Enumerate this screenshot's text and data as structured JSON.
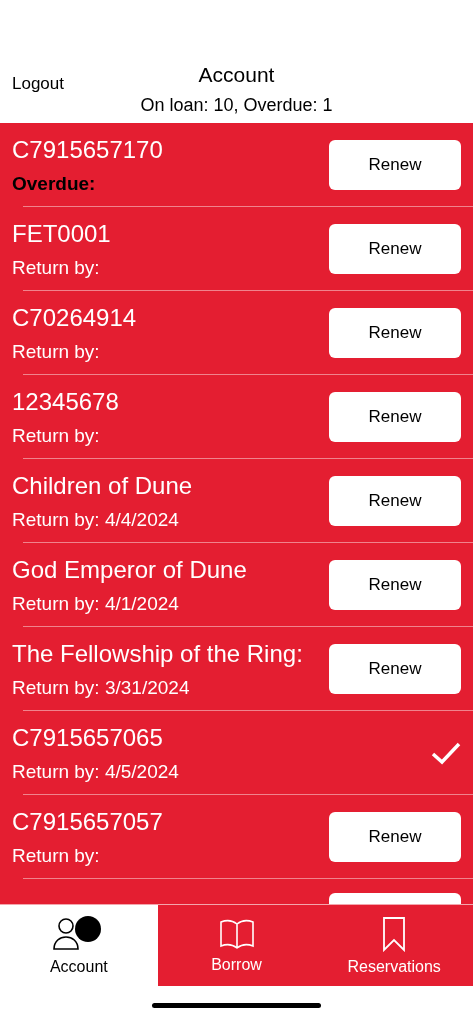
{
  "header": {
    "logout": "Logout",
    "title": "Account",
    "summary": "On loan: 10, Overdue: 1"
  },
  "loans": [
    {
      "title": "C7915657170",
      "due": "Overdue:",
      "overdue": true,
      "kind": "renewable",
      "action": "Renew"
    },
    {
      "title": "FET0001",
      "due": "Return by:",
      "overdue": false,
      "kind": "renewable",
      "action": "Renew"
    },
    {
      "title": "C70264914",
      "due": "Return by:",
      "overdue": false,
      "kind": "renewable",
      "action": "Renew"
    },
    {
      "title": "12345678",
      "due": "Return by:",
      "overdue": false,
      "kind": "renewable",
      "action": "Renew"
    },
    {
      "title": "Children of Dune",
      "due": "Return by: 4/4/2024",
      "overdue": false,
      "kind": "renewable",
      "action": "Renew"
    },
    {
      "title": "God Emperor of Dune",
      "due": "Return by: 4/1/2024",
      "overdue": false,
      "kind": "renewable",
      "action": "Renew"
    },
    {
      "title": "The Fellowship of the Ring:",
      "due": "Return by: 3/31/2024",
      "overdue": false,
      "kind": "renewable",
      "action": "Renew"
    },
    {
      "title": "C7915657065",
      "due": "Return by: 4/5/2024",
      "overdue": false,
      "kind": "renewed"
    },
    {
      "title": "C7915657057",
      "due": "Return by:",
      "overdue": false,
      "kind": "renewable",
      "action": "Renew"
    },
    {
      "kind": "renewable"
    }
  ],
  "tabs": [
    {
      "label": "Account",
      "selected": true,
      "kind": "person"
    },
    {
      "label": "Borrow",
      "selected": false,
      "kind": "book"
    },
    {
      "label": "Reservations",
      "selected": false,
      "kind": "bookmark"
    }
  ]
}
